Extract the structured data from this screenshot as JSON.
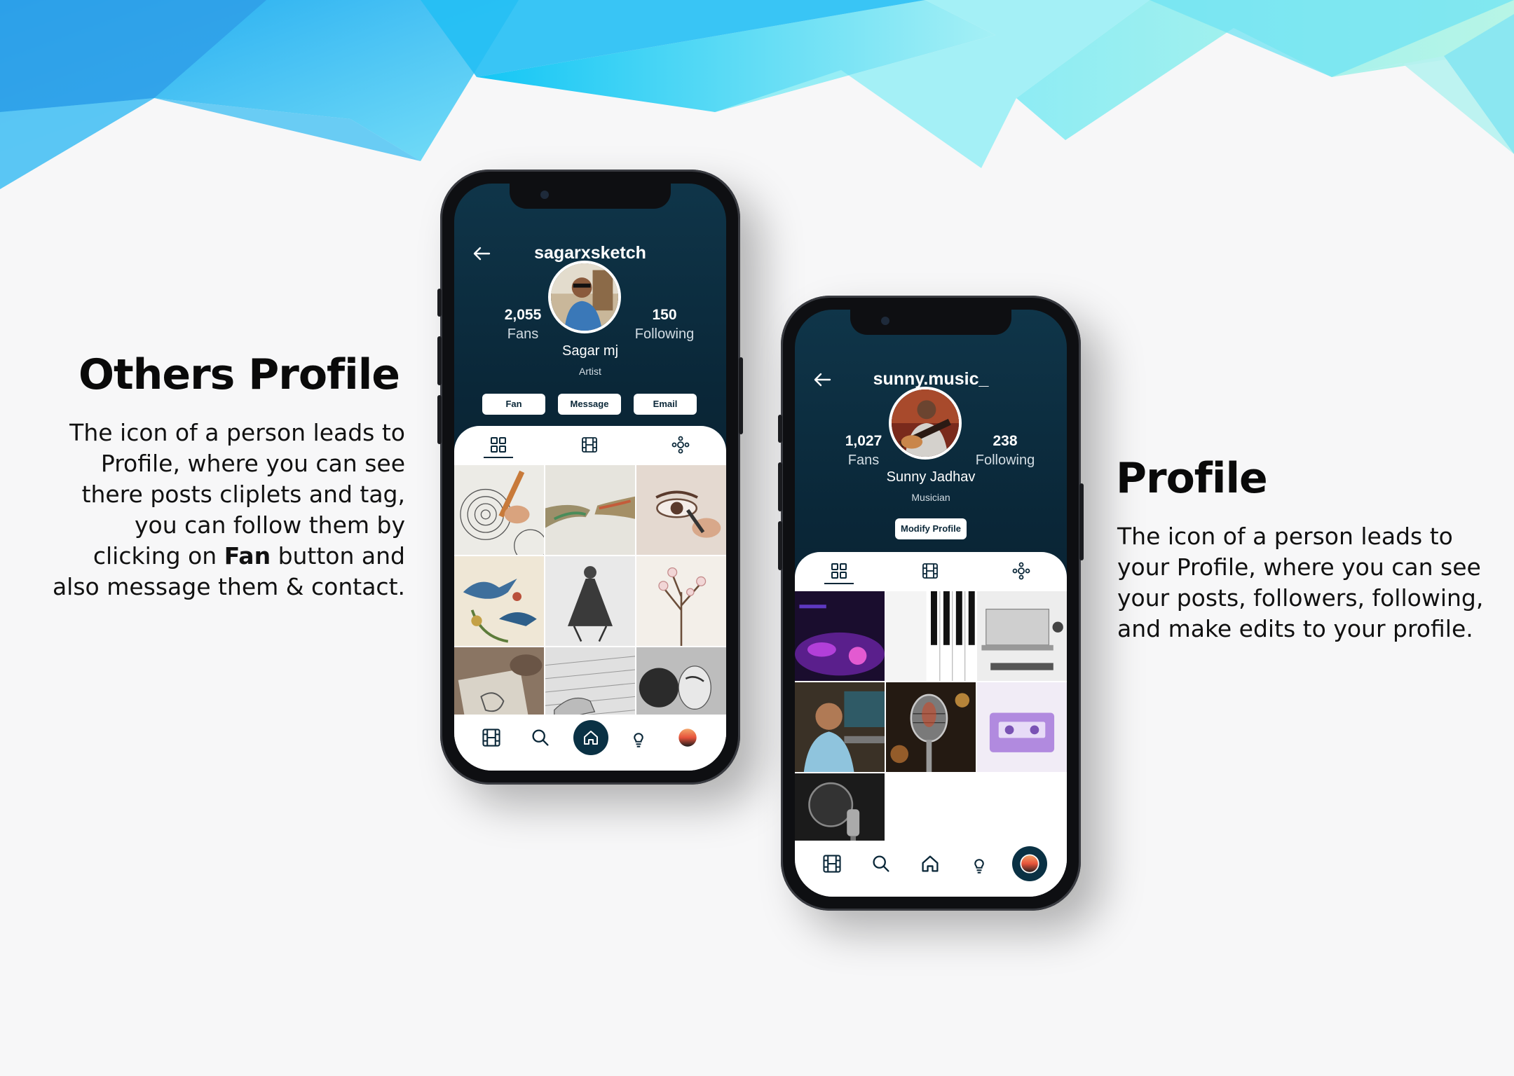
{
  "left": {
    "title": "Others Profile",
    "body_lines": [
      "The icon of a person leads to",
      "Profile, where you can see",
      "there posts cliplets and tag,",
      "you can follow them by"
    ],
    "line5_pre": "clicking on ",
    "line5_bold": "Fan",
    "line5_post": " button and",
    "line6": "also message them & contact."
  },
  "right": {
    "title": "Profile",
    "body_lines": [
      "The icon of a person leads to",
      "your Profile, where you can see",
      "your posts, followers, following,",
      "and make edits to your profile."
    ]
  },
  "phone1": {
    "username": "sagarxsketch",
    "fans_count": "2,055",
    "fans_label": "Fans",
    "following_count": "150",
    "following_label": "Following",
    "name": "Sagar mj",
    "role": "Artist",
    "buttons": [
      "Fan",
      "Message",
      "Email"
    ],
    "tabs": [
      "grid-icon",
      "film-icon",
      "tag-icon"
    ],
    "nav": [
      "film-icon",
      "search-icon",
      "home-icon",
      "bulb-icon",
      "avatar-icon"
    ],
    "active_nav": "home"
  },
  "phone2": {
    "username": "sunny.music_",
    "fans_count": "1,027",
    "fans_label": "Fans",
    "following_count": "238",
    "following_label": "Following",
    "name": "Sunny Jadhav",
    "role": "Musician",
    "button": "Modify Profile",
    "tabs": [
      "grid-icon",
      "film-icon",
      "tag-icon"
    ],
    "nav": [
      "film-icon",
      "search-icon",
      "home-icon",
      "bulb-icon",
      "avatar-icon"
    ],
    "active_nav": "profile"
  },
  "colors": {
    "navy": "#0a2738",
    "accent_cyan": "#37c8f5"
  }
}
